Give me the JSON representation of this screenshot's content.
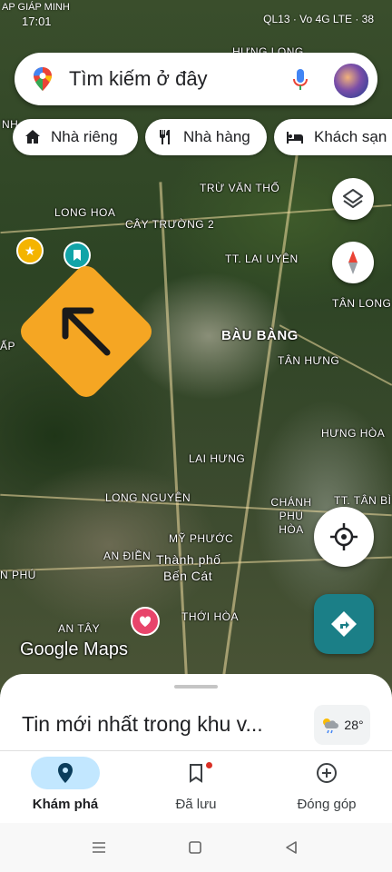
{
  "status": {
    "time": "17:01",
    "carrier_label": "AP GIÁP MINH",
    "indicators": "QL13 · Vo 4G LTE · 38"
  },
  "search": {
    "placeholder": "Tìm kiếm ở đây"
  },
  "chips": [
    {
      "label": "Nhà riêng",
      "icon": "home-icon"
    },
    {
      "label": "Nhà hàng",
      "icon": "restaurant-icon"
    },
    {
      "label": "Khách sạn",
      "icon": "hotel-icon"
    }
  ],
  "map_labels": {
    "hung_long": "HƯNG LONG",
    "tru_van_tho": "TRỪ VĂN THỐ",
    "long_hoa": "LONG HOA",
    "cay_truong": "CÂY TRƯỜNG 2",
    "tt_lai_uyen": "TT. LAI UYÊN",
    "tan_long": "TÂN LONG",
    "bau_bang": "BÀU BÀNG",
    "tan_hung": "TÂN HƯNG",
    "hung_hoa": "HƯNG HÒA",
    "lai_hung": "LAI HƯNG",
    "long_nguyen": "LONG NGUYÊN",
    "chanh_phu_hoa": "CHÁNH PHÚ HÒA",
    "tt_tan_binh": "TT. TÂN BÌ",
    "my_phuoc": "MỸ PHƯỚC",
    "an_dien": "AN ĐIỀN",
    "thanh_pho": "Thành phố",
    "ben_cat": "Bến Cát",
    "phu": "N PHÚ",
    "thoi_hoa": "THỚI HÒA",
    "an_tay": "AN TÂY",
    "ap": "ẤP",
    "nh": "NH"
  },
  "map_logo": "Google Maps",
  "sheet": {
    "title": "Tin mới nhất trong khu v...",
    "weather_temp": "28°",
    "weather_icon": "cloud-sun-rain-icon"
  },
  "nav": [
    {
      "label": "Khám phá",
      "icon": "location-pin-icon",
      "active": true
    },
    {
      "label": "Đã lưu",
      "icon": "bookmark-icon",
      "active": false
    },
    {
      "label": "Đóng góp",
      "icon": "add-circle-icon",
      "active": false
    }
  ],
  "colors": {
    "accent": "#1a73e8",
    "nav_active_bg": "#c2e7ff",
    "directions": "#1b7f87",
    "sign": "#f5a623"
  }
}
